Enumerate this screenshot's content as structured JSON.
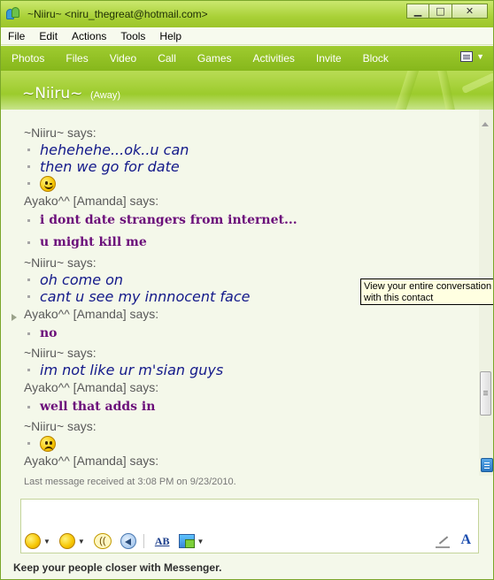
{
  "window": {
    "title": "~Niiru~ <niru_thegreat@hotmail.com>",
    "buttons": {
      "minimize": "▁",
      "maximize": "□",
      "close": "✕"
    }
  },
  "menu": [
    "File",
    "Edit",
    "Actions",
    "Tools",
    "Help"
  ],
  "toolbar": [
    "Photos",
    "Files",
    "Video",
    "Call",
    "Games",
    "Activities",
    "Invite",
    "Block"
  ],
  "contact": {
    "name": "~Niiru~",
    "status": "(Away)"
  },
  "conversation": [
    {
      "sender": "~Niiru~ says:",
      "style": "niiru",
      "lines": [
        {
          "text": "hehehehe...ok..u can"
        },
        {
          "text": "then we go for date"
        },
        {
          "emoticon": "wink-smiley"
        }
      ]
    },
    {
      "sender": "Ayako^^ [Amanda] says:",
      "style": "ayako",
      "lines": [
        {
          "text": "i dont date strangers from internet..."
        },
        {
          "text": "u might kill me"
        }
      ]
    },
    {
      "sender": "~Niiru~ says:",
      "style": "niiru",
      "lines": [
        {
          "text": "oh come on"
        },
        {
          "text": "cant u see my innnocent face"
        }
      ]
    },
    {
      "sender": "Ayako^^ [Amanda] says:",
      "style": "ayako",
      "lines": [
        {
          "text": "no"
        }
      ]
    },
    {
      "sender": "~Niiru~ says:",
      "style": "niiru",
      "lines": [
        {
          "text": "im not like ur m'sian guys"
        }
      ]
    },
    {
      "sender": "Ayako^^ [Amanda] says:",
      "style": "ayako",
      "lines": [
        {
          "text": "well that adds in"
        }
      ]
    },
    {
      "sender": "~Niiru~ says:",
      "style": "niiru",
      "lines": [
        {
          "emoticon": "sad-smiley"
        }
      ]
    },
    {
      "sender": "Ayako^^ [Amanda] says:",
      "style": "ayako",
      "lines": []
    }
  ],
  "last_message": "Last message received at 3:08 PM on 9/23/2010.",
  "tooltip": {
    "line1": "View your entire conversation h",
    "line2": "with this contact"
  },
  "input": {
    "value": "",
    "toolbar": {
      "voice_clip": "((",
      "font": "AB",
      "format": "A"
    }
  },
  "footer": "Keep your people closer with Messenger.",
  "colors": {
    "niiru_text": "#13198a",
    "ayako_text": "#6b0e7a",
    "accent_green": "#9cc52a"
  }
}
